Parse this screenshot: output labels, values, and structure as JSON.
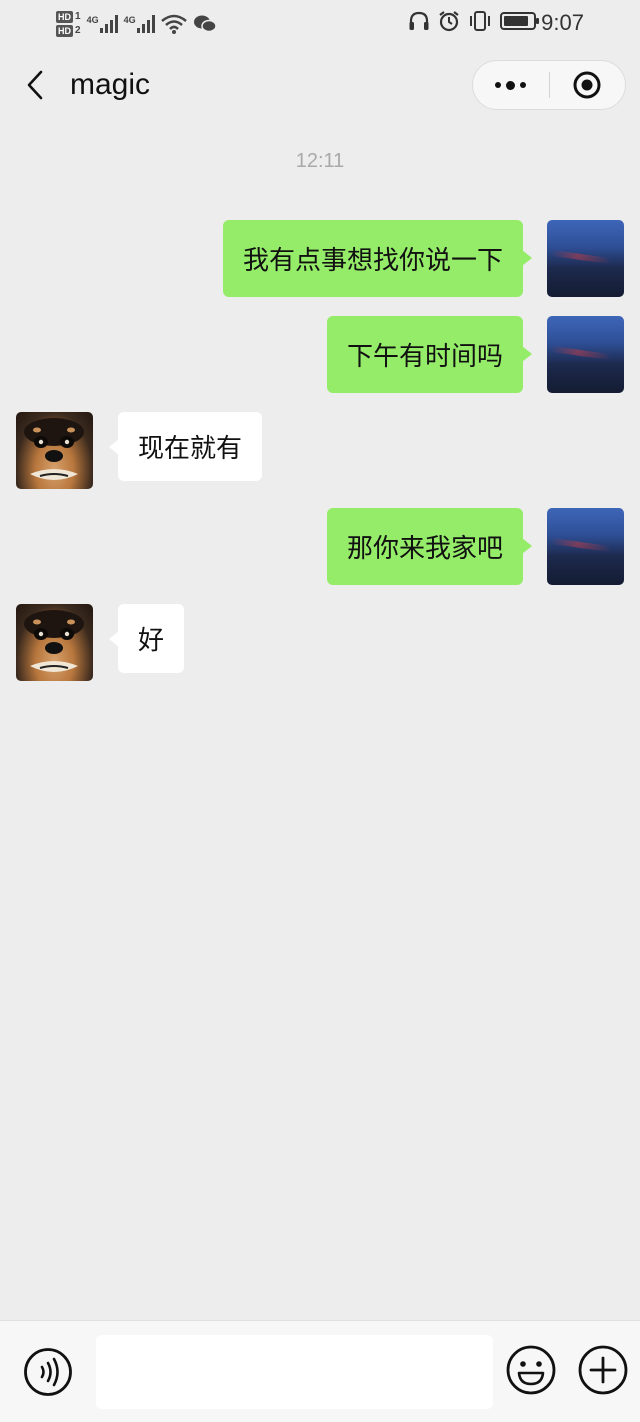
{
  "status_bar": {
    "sim1_badge": "HD",
    "sim1_index": "1",
    "sim2_badge": "HD",
    "sim2_index": "2",
    "network1": "4G",
    "network2": "4G",
    "time": "9:07",
    "battery_level": 0.85,
    "icons": [
      "wifi-icon",
      "wechat-icon",
      "headphones-icon",
      "alarm-icon",
      "vibrate-icon",
      "battery-icon"
    ]
  },
  "header": {
    "title": "magic",
    "back_icon": "chevron-left-icon",
    "more_icon": "more-dots-icon",
    "close_icon": "target-circle-icon"
  },
  "chat": {
    "timestamp": "12:11",
    "messages": [
      {
        "from": "me",
        "text": "我有点事想找你说一下"
      },
      {
        "from": "me",
        "text": "下午有时间吗"
      },
      {
        "from": "other",
        "text": "现在就有"
      },
      {
        "from": "me",
        "text": "那你来我家吧"
      },
      {
        "from": "other",
        "text": "好"
      }
    ]
  },
  "input_bar": {
    "voice_icon": "voice-icon",
    "text_value": "",
    "emoji_icon": "emoji-icon",
    "plus_icon": "plus-icon"
  },
  "colors": {
    "background": "#ededed",
    "my_bubble": "#95ec69",
    "other_bubble": "#ffffff",
    "timestamp_text": "#a9a9a9"
  }
}
